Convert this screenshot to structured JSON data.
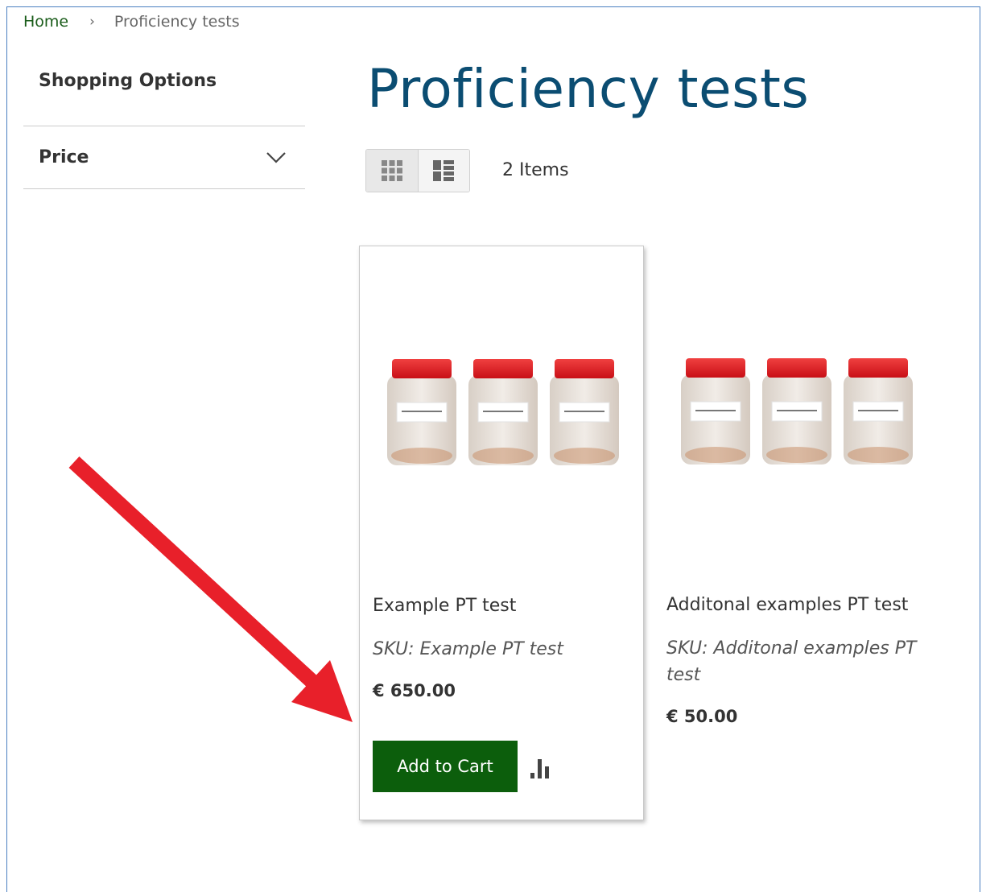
{
  "breadcrumb": {
    "home": "Home",
    "separator": "›",
    "current": "Proficiency tests"
  },
  "sidebar": {
    "title": "Shopping Options",
    "filters": [
      {
        "label": "Price",
        "icon": "chevron-down-icon"
      }
    ]
  },
  "main": {
    "title": "Proficiency tests",
    "view_modes": [
      {
        "name": "grid",
        "icon": "grid-icon",
        "active": true
      },
      {
        "name": "list",
        "icon": "list-icon",
        "active": false
      }
    ],
    "item_count": "2 Items"
  },
  "products": [
    {
      "name": "Example PT test",
      "sku": "SKU: Example PT test",
      "price": "€ 650.00",
      "add_to_cart_label": "Add to Cart",
      "highlighted": true
    },
    {
      "name": "Additonal examples PT test",
      "sku": "SKU: Additonal examples PT test",
      "price": "€ 50.00"
    }
  ],
  "colors": {
    "title": "#0b4d72",
    "button": "#0c5e0c",
    "breadcrumb_link": "#1a5c1a",
    "jar_lid": "#e3141b",
    "annotation_arrow": "#e8202a"
  }
}
